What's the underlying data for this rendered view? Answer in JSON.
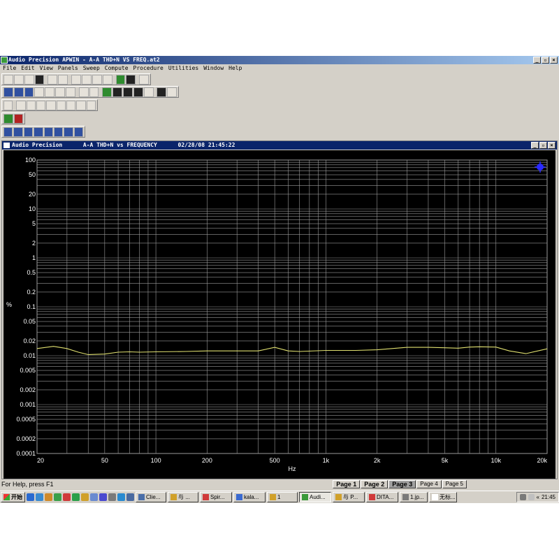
{
  "window": {
    "title": "Audio Precision APWIN - A-A THD+N VS FREQ.at2",
    "controls": [
      "_",
      "▫",
      "×"
    ]
  },
  "menu": [
    "File",
    "Edit",
    "View",
    "Panels",
    "Sweep",
    "Compute",
    "Procedure",
    "Utilities",
    "Window",
    "Help"
  ],
  "graph_window": {
    "app": "Audio Precision",
    "name": "A-A THD+N vs FREQUENCY",
    "timestamp": "02/28/08 21:45:22",
    "controls": [
      "_",
      "▫",
      "×"
    ]
  },
  "chart_data": {
    "type": "line",
    "xlabel": "Hz",
    "ylabel": "%",
    "xscale": "log",
    "yscale": "log",
    "xlim": [
      20,
      20000
    ],
    "ylim": [
      0.0001,
      100
    ],
    "xtick_labels": [
      "20",
      "50",
      "100",
      "200",
      "500",
      "1k",
      "2k",
      "5k",
      "10k",
      "20k"
    ],
    "xtick_values": [
      20,
      50,
      100,
      200,
      500,
      1000,
      2000,
      5000,
      10000,
      20000
    ],
    "ytick_labels": [
      "100",
      "50",
      "20",
      "10",
      "5",
      "2",
      "1",
      "0.5",
      "0.2",
      "0.1",
      "0.05",
      "0.02",
      "0.01",
      "0.005",
      "0.002",
      "0.001",
      "0.0005",
      "0.0002",
      "0.0001"
    ],
    "ytick_values": [
      100,
      50,
      20,
      10,
      5,
      2,
      1,
      0.5,
      0.2,
      0.1,
      0.05,
      0.02,
      0.01,
      0.005,
      0.002,
      0.001,
      0.0005,
      0.0002,
      0.0001
    ],
    "grid": true,
    "background": "#000000",
    "grid_color": "#9a9a9a",
    "series": [
      {
        "color": "#e0e070",
        "x": [
          20,
          25,
          30,
          35,
          40,
          50,
          60,
          70,
          80,
          100,
          150,
          200,
          300,
          400,
          500,
          600,
          700,
          1000,
          1500,
          2000,
          3000,
          4000,
          5000,
          6000,
          7000,
          8000,
          10000,
          12000,
          15000,
          20000
        ],
        "y": [
          0.014,
          0.0155,
          0.014,
          0.0118,
          0.0105,
          0.0108,
          0.0118,
          0.012,
          0.0118,
          0.012,
          0.0122,
          0.0125,
          0.0125,
          0.0125,
          0.0148,
          0.0125,
          0.0122,
          0.0128,
          0.0128,
          0.0132,
          0.0148,
          0.0148,
          0.0145,
          0.0142,
          0.015,
          0.0152,
          0.015,
          0.0125,
          0.011,
          0.0138
        ]
      }
    ]
  },
  "status": {
    "help_text": "For Help, press F1",
    "pages": [
      "Page 1",
      "Page 2",
      "Page 3",
      "Page 4",
      "Page 5"
    ],
    "selected_page": "Page 3"
  },
  "taskbar": {
    "start_label": "开始",
    "tasks": [
      "Clie...",
      "与 ...",
      "Spir...",
      "kala...",
      "1",
      "Audi...",
      "与 P...",
      "DITA...",
      "1.jp...",
      "无标..."
    ],
    "active_task": "Audi...",
    "clock": "21:45"
  },
  "colors": {
    "titlebar": "#0a246a",
    "chrome": "#d4d0c8",
    "marker": "#2a2aff"
  },
  "icons": {
    "app": "audio-precision-icon",
    "marker": "cursor-marker-icon"
  }
}
